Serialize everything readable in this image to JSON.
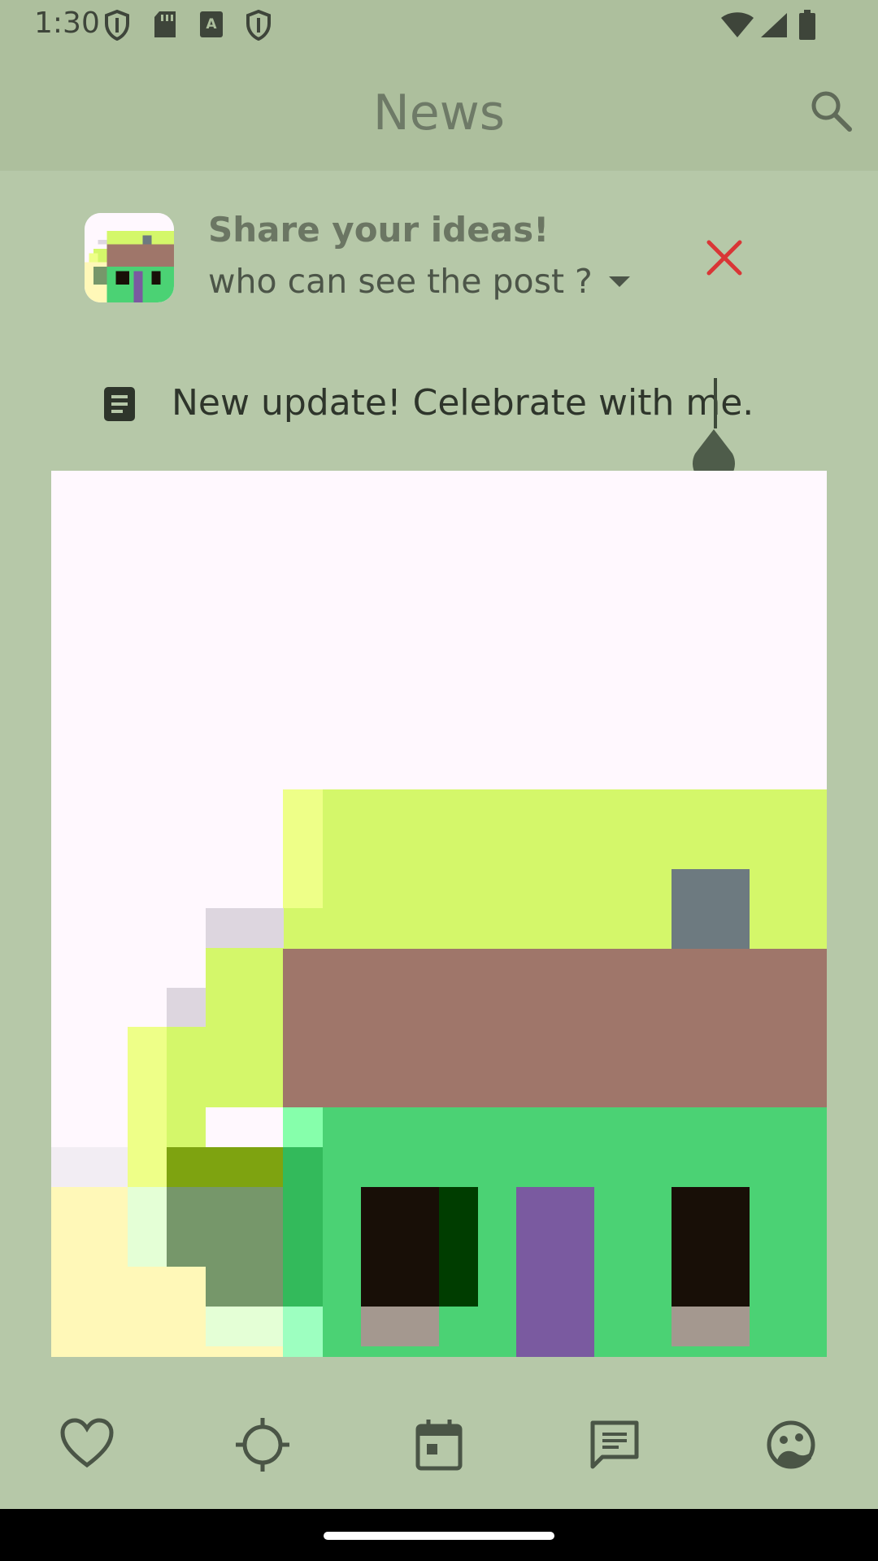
{
  "status_bar": {
    "time": "1:30",
    "icons": [
      "shield-icon",
      "sd-card-icon",
      "text-a-icon",
      "shield-icon",
      "wifi-icon",
      "signal-icon",
      "battery-icon"
    ]
  },
  "app_bar": {
    "title": "News",
    "search_icon": "search-icon"
  },
  "composer": {
    "title": "Share your ideas!",
    "visibility_label": "who can see the post ?",
    "close_icon": "close-icon",
    "close_color": "#d93636",
    "post_icon": "book-icon",
    "post_text": "New update! Celebrate with me."
  },
  "bottom_nav": {
    "items": [
      {
        "icon": "heart-icon"
      },
      {
        "icon": "crosshair-icon"
      },
      {
        "icon": "calendar-icon"
      },
      {
        "icon": "chat-icon"
      },
      {
        "icon": "face-icon"
      }
    ]
  },
  "colors": {
    "background": "#b6c8a8",
    "app_bar": "#adbf9d",
    "accent_close": "#d93636"
  }
}
